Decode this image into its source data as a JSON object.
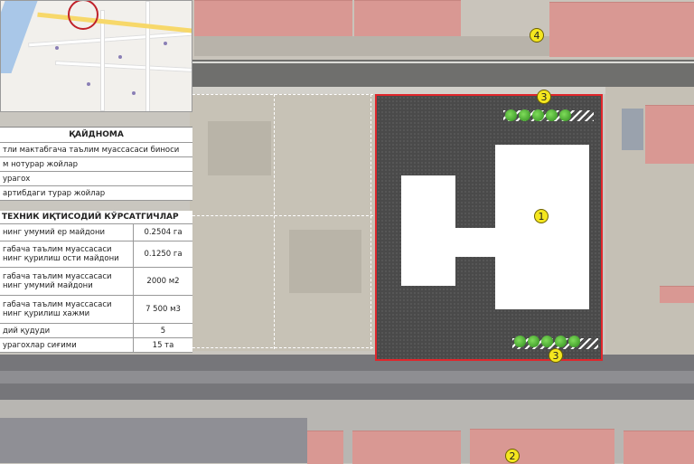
{
  "map_markers": {
    "site": "1",
    "south_block": "2",
    "green_strip": "3",
    "north_block": "4"
  },
  "legend": {
    "title": "ҚАЙДНОМА",
    "items": [
      "тли мактабгача таълим муассасаси биноси",
      "м нотурар жойлар",
      "урагох",
      "артибдаги турар жойлар"
    ]
  },
  "parameters": {
    "title": "ТЕХНИК ИҚТИСОДИЙ КЎРСАТГИЧЛАР",
    "rows": [
      {
        "label": "нинг умумий ер майдони",
        "value": "0.2504 га"
      },
      {
        "label": "габача таълим муассасаси нинг қурилиш ости майдони",
        "value": "0.1250 га"
      },
      {
        "label": "габача таълим муассасаси нинг умумий майдони",
        "value": "2000 м2"
      },
      {
        "label": "габача таълим муассасаси нинг қурилиш хажми",
        "value": "7 500 м3"
      },
      {
        "label": "дий қудуди",
        "value": "5"
      },
      {
        "label": "урагохлар сиғими",
        "value": "15 та"
      }
    ]
  },
  "colors": {
    "site_border": "#e0262b",
    "marker_fill": "#f4e61f",
    "site_fill": "#4a4a4a"
  }
}
